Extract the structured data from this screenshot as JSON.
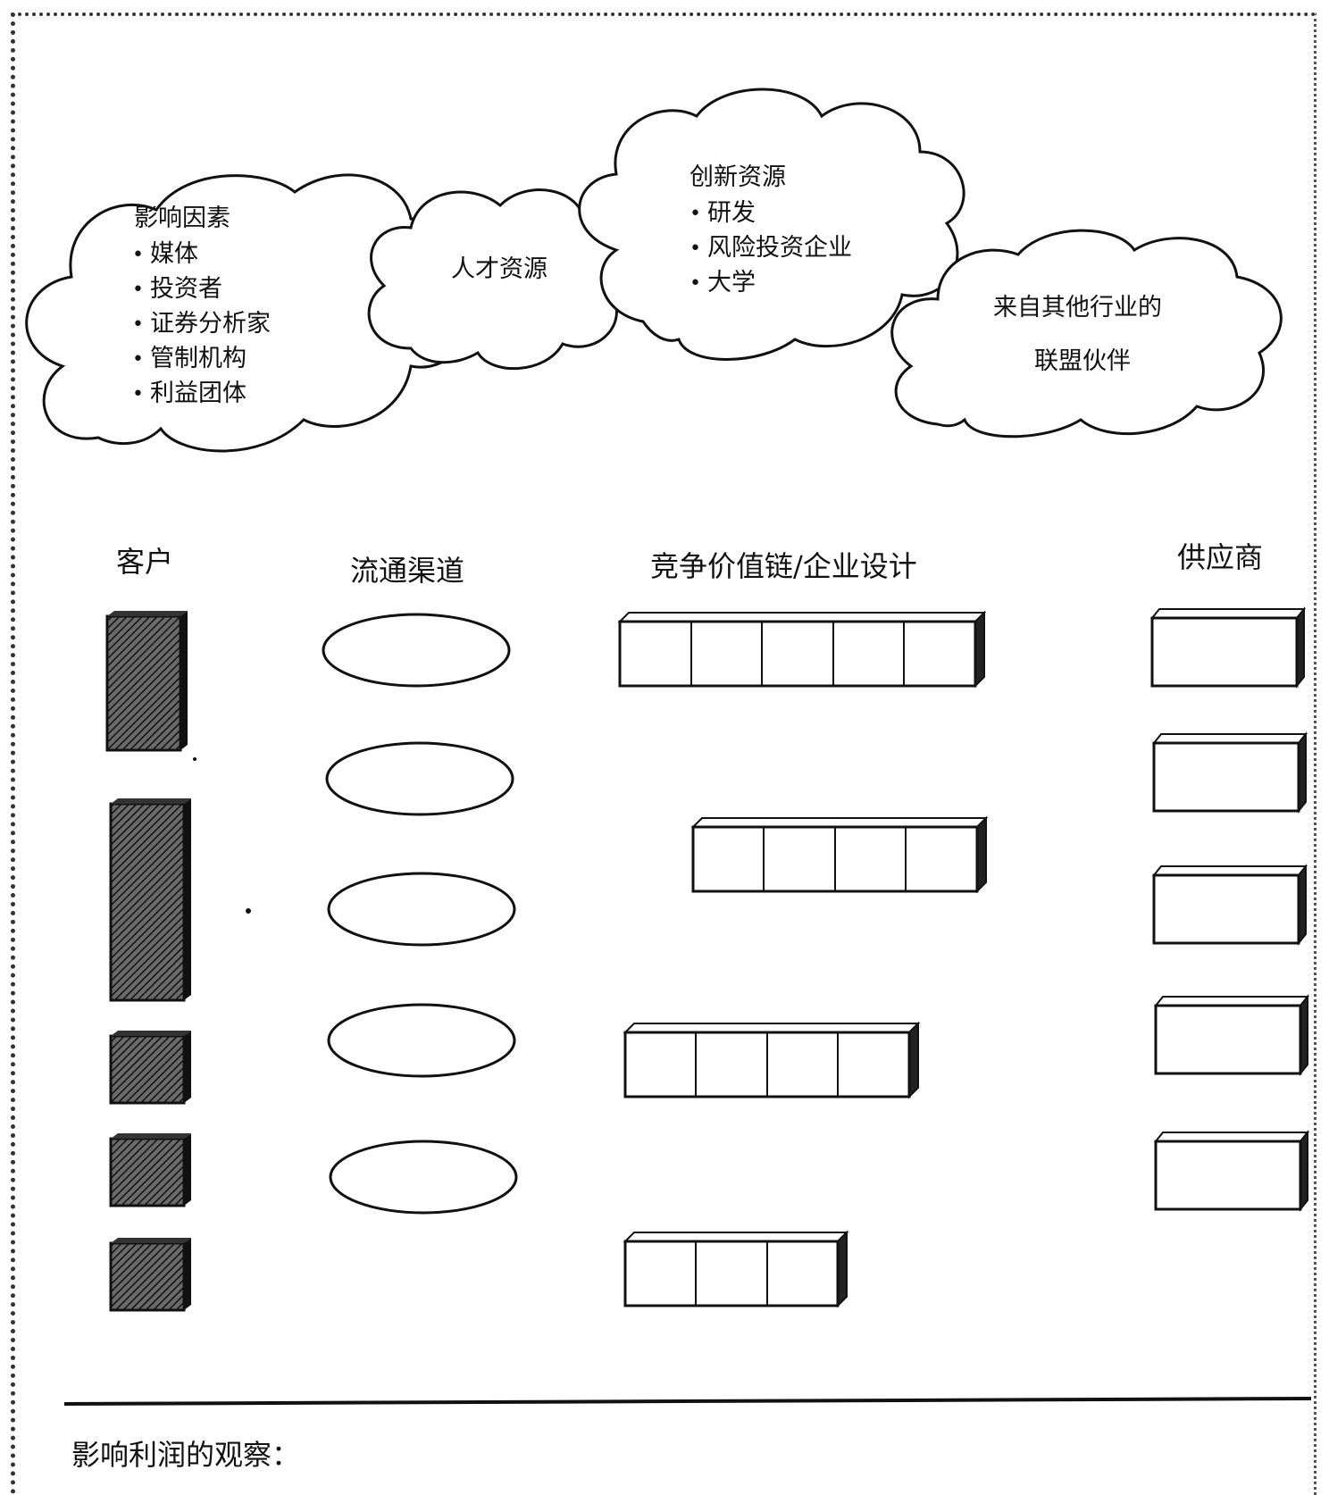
{
  "clouds": {
    "influence": {
      "title": "影响因素",
      "items": [
        "媒体",
        "投资者",
        "证券分析家",
        "管制机构",
        "利益团体"
      ]
    },
    "talent": {
      "label": "人才资源"
    },
    "innovation": {
      "title": "创新资源",
      "items": [
        "研发",
        "风险投资企业",
        "大学"
      ]
    },
    "alliance": {
      "line1": "来自其他行业的",
      "line2": "联盟伙伴"
    }
  },
  "columns": {
    "customers": "客户",
    "channels": "流通渠道",
    "value_chain": "竞争价值链/企业设计",
    "suppliers": "供应商"
  },
  "bullet": "•",
  "footer": {
    "label": "影响利润的观察："
  },
  "colors": {
    "ink": "#111111",
    "hatch": "#333333",
    "paper": "#ffffff"
  }
}
